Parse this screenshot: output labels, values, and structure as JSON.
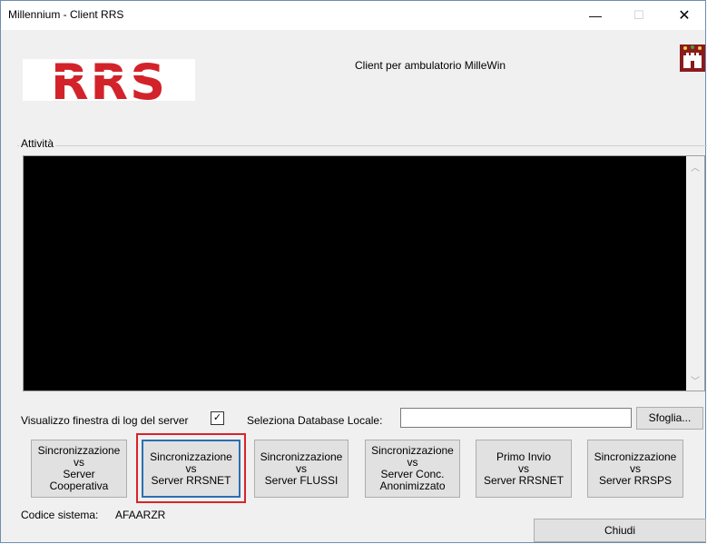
{
  "window": {
    "title": "Millennium - Client RRS",
    "minimize_label": "—",
    "maximize_label": "☐",
    "close_label": "✕"
  },
  "header": {
    "logo_text": "RRS",
    "subtitle": "Client per ambulatorio MilleWin",
    "app_icon": "castle-icon"
  },
  "activity": {
    "group_label": "Attività"
  },
  "log_option": {
    "label": "Visualizzo finestra di log del server",
    "checked": true,
    "check_glyph": "✓"
  },
  "database": {
    "label": "Seleziona Database Locale:",
    "value": "",
    "browse_label": "Sfoglia..."
  },
  "actions": [
    {
      "label": "Sincronizzazione\nvs\nServer\nCooperativa"
    },
    {
      "label": "Sincronizzazione\nvs\nServer RRSNET"
    },
    {
      "label": "Sincronizzazione\nvs\nServer FLUSSI"
    },
    {
      "label": "Sincronizzazione\nvs\nServer Conc.\nAnonimizzato"
    },
    {
      "label": "Primo Invio\nvs\nServer RRSNET"
    },
    {
      "label": "Sincronizzazione\nvs\nServer RRSPS"
    }
  ],
  "footer": {
    "code_label": "Codice sistema:",
    "code_value": "AFAARZR",
    "close_button": "Chiudi"
  },
  "colors": {
    "logo_red": "#d2232a",
    "highlight_red": "#d7242a",
    "focus_blue": "#2a6fb2"
  }
}
